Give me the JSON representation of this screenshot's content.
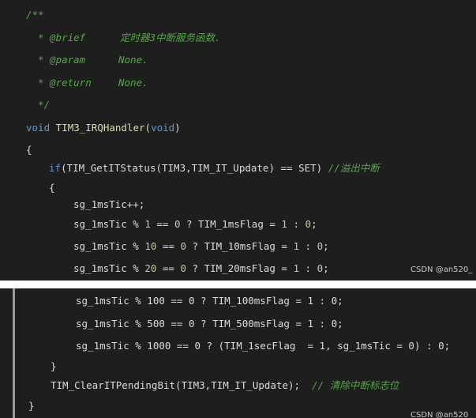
{
  "block1": {
    "doc_open": "/**",
    "brief_tag": "* @brief",
    "brief_text": "定时器3中断服务函数.",
    "param_tag": "* @param",
    "param_text": "None.",
    "return_tag": "* @return",
    "return_text": "None.",
    "doc_close": "*/",
    "sig_void": "void",
    "sig_name": "TIM3_IRQHandler(",
    "sig_param": "void",
    "sig_close": ")",
    "brace_open": "{",
    "if_kw": "if",
    "if_cond": "(TIM_GetITStatus(TIM3,TIM_IT_Update) == SET)",
    "if_comment": "//溢出中断",
    "if_brace": "{",
    "l1": "sg_1msTic++;",
    "l2a": "sg_1msTic % ",
    "l2n1": "1",
    "l2b": " == ",
    "l2n2": "0",
    "l2c": " ? TIM_1msFlag = ",
    "l2n3": "1",
    "l2d": " : ",
    "l2n4": "0",
    "l2e": ";",
    "l3a": "sg_1msTic % ",
    "l3n1": "10",
    "l3b": " == ",
    "l3n2": "0",
    "l3c": " ? TIM_10msFlag = ",
    "l3n3": "1",
    "l3d": " : ",
    "l3n4": "0",
    "l3e": ";",
    "l4a": "sg_1msTic % ",
    "l4n1": "20",
    "l4b": " == ",
    "l4n2": "0",
    "l4c": " ? TIM_20msFlag = ",
    "l4n3": "1",
    "l4d": " : ",
    "l4n4": "0",
    "l4e": ";",
    "watermark": "CSDN @an520_"
  },
  "block2": {
    "l5": "sg_1msTic % 100 == 0 ? TIM_100msFlag = 1 : 0;",
    "l6": "sg_1msTic % 500 == 0 ? TIM_500msFlag = 1 : 0;",
    "l7": "sg_1msTic % 1000 == 0 ? (TIM_1secFlag  = 1, sg_1msTic = 0) : 0;",
    "if_close": "}",
    "clear_call": "TIM_ClearITPendingBit(TIM3,TIM_IT_Update);",
    "clear_comment": "// 清除中断标志位",
    "brace_close": "}",
    "watermark": "CSDN @an520_"
  }
}
